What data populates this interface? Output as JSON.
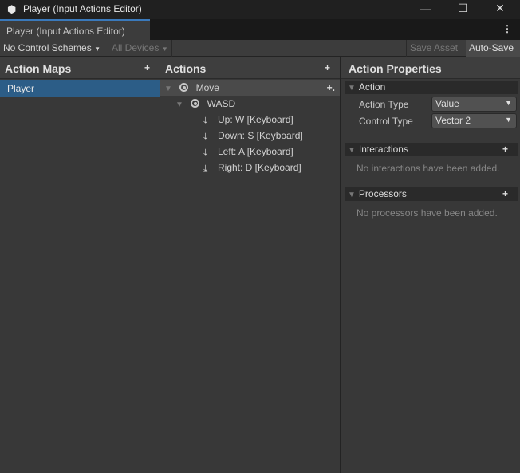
{
  "window": {
    "title": "Player (Input Actions Editor)"
  },
  "tab": {
    "label": "Player (Input Actions Editor)"
  },
  "toolbar": {
    "control_schemes": "No Control Schemes",
    "devices": "All Devices",
    "save_asset": "Save Asset",
    "auto_save": "Auto-Save"
  },
  "action_maps": {
    "title": "Action Maps",
    "items": [
      {
        "label": "Player"
      }
    ]
  },
  "actions": {
    "title": "Actions",
    "action": "Move",
    "composite": "WASD",
    "bindings": [
      "Up: W [Keyboard]",
      "Down: S [Keyboard]",
      "Left: A [Keyboard]",
      "Right: D [Keyboard]"
    ]
  },
  "properties": {
    "title": "Action Properties",
    "action_section": "Action",
    "action_type_label": "Action Type",
    "action_type_value": "Value",
    "control_type_label": "Control Type",
    "control_type_value": "Vector 2",
    "interactions_section": "Interactions",
    "interactions_empty": "No interactions have been added.",
    "processors_section": "Processors",
    "processors_empty": "No processors have been added."
  },
  "colors": {
    "selection": "#2c5d87",
    "accent": "#3a79bb"
  }
}
